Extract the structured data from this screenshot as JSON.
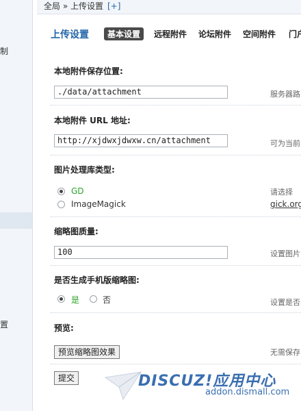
{
  "sidebar": {
    "items": [
      {
        "label": "制"
      },
      {
        "label": "置"
      }
    ]
  },
  "breadcrumb": {
    "text": "全局 » 上传设置",
    "add_label": "[+]"
  },
  "header": {
    "title": "上传设置",
    "tabs": [
      {
        "label": "基本设置",
        "active": true
      },
      {
        "label": "远程附件",
        "active": false
      },
      {
        "label": "论坛附件",
        "active": false
      },
      {
        "label": "空间附件",
        "active": false
      },
      {
        "label": "门户",
        "active": false
      }
    ]
  },
  "form": {
    "attach_dir": {
      "label": "本地附件保存位置:",
      "value": "./data/attachment",
      "hint": "服务器路"
    },
    "attach_url": {
      "label": "本地附件 URL 地址:",
      "value": "http://xjdwxjdwxw.cn/attachment",
      "hint": "可为当前"
    },
    "image_lib": {
      "label": "图片处理库类型:",
      "options": [
        {
          "label": "GD",
          "selected": true
        },
        {
          "label": "ImageMagick",
          "selected": false
        }
      ],
      "hint": "请选择 ",
      "hint_link": "gick.org"
    },
    "thumb_quality": {
      "label": "缩略图质量:",
      "value": "100",
      "hint": "设置图片"
    },
    "mobile_thumb": {
      "label": "是否生成手机版缩略图:",
      "options": [
        {
          "label": "是",
          "selected": true
        },
        {
          "label": "否",
          "selected": false
        }
      ],
      "hint": "设置是否"
    },
    "preview": {
      "label": "预览:",
      "button": "预览缩略图效果",
      "hint": "无需保存"
    },
    "submit_label": "提交"
  },
  "watermark": {
    "brand": "DISCUZ!应用中心",
    "url": "addon.dismall.com"
  },
  "colors": {
    "accent": "#2366a8",
    "selected_option": "#2aa32a",
    "tab_active_bg": "#4a4a4a"
  }
}
